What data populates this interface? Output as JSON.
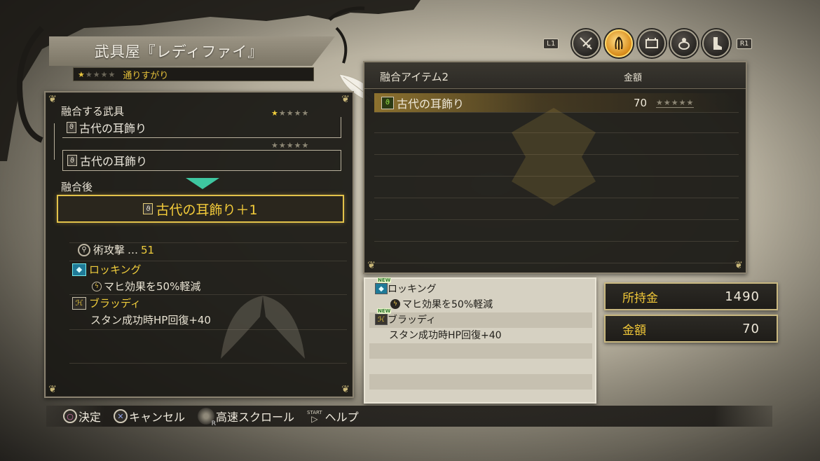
{
  "shop": {
    "name": "武具屋『レディファイ』",
    "rank_stars_filled": 1,
    "rank_stars_total": 5,
    "rank_label": "通りすがり"
  },
  "category_tabs": {
    "prev_hint": "L1",
    "next_hint": "R1",
    "tabs": [
      {
        "icon": "sword-icon",
        "active": false
      },
      {
        "icon": "feather-icon",
        "active": true
      },
      {
        "icon": "armor-icon",
        "active": false
      },
      {
        "icon": "ring-icon",
        "active": false
      },
      {
        "icon": "boot-icon",
        "active": false
      }
    ]
  },
  "fusion": {
    "header": "融合する武具",
    "slot1": {
      "name": "古代の耳飾り",
      "stars_filled": 1,
      "stars_total": 5
    },
    "slot2": {
      "name": "古代の耳飾り",
      "stars_filled": 0,
      "stars_total": 5
    },
    "result_header": "融合後",
    "result_name": "古代の耳飾り＋1",
    "stat_label": "術攻撃",
    "stat_sep": "…",
    "stat_value": "51",
    "abilities": [
      {
        "name": "ロッキング",
        "effect": "マヒ効果を50%軽減"
      },
      {
        "name": "ブラッディ",
        "effect": "スタン成功時HP回復+40"
      }
    ]
  },
  "item_list": {
    "col_item": "融合アイテム2",
    "col_price": "金額",
    "rows": [
      {
        "name": "古代の耳飾り",
        "price": "70",
        "stars_filled": 0,
        "stars_total": 5,
        "selected": true
      }
    ]
  },
  "detail": {
    "new_tag": "NEW",
    "abilities": [
      {
        "name": "ロッキング",
        "effect": "マヒ効果を50%軽減"
      },
      {
        "name": "ブラッディ",
        "effect": "スタン成功時HP回復+40"
      }
    ]
  },
  "money": {
    "held_label": "所持金",
    "held_value": "1490",
    "price_label": "金額",
    "price_value": "70"
  },
  "help": {
    "confirm": "決定",
    "cancel": "キャンセル",
    "fast_scroll": "高速スクロール",
    "start_label": "START",
    "help": "ヘルプ"
  }
}
